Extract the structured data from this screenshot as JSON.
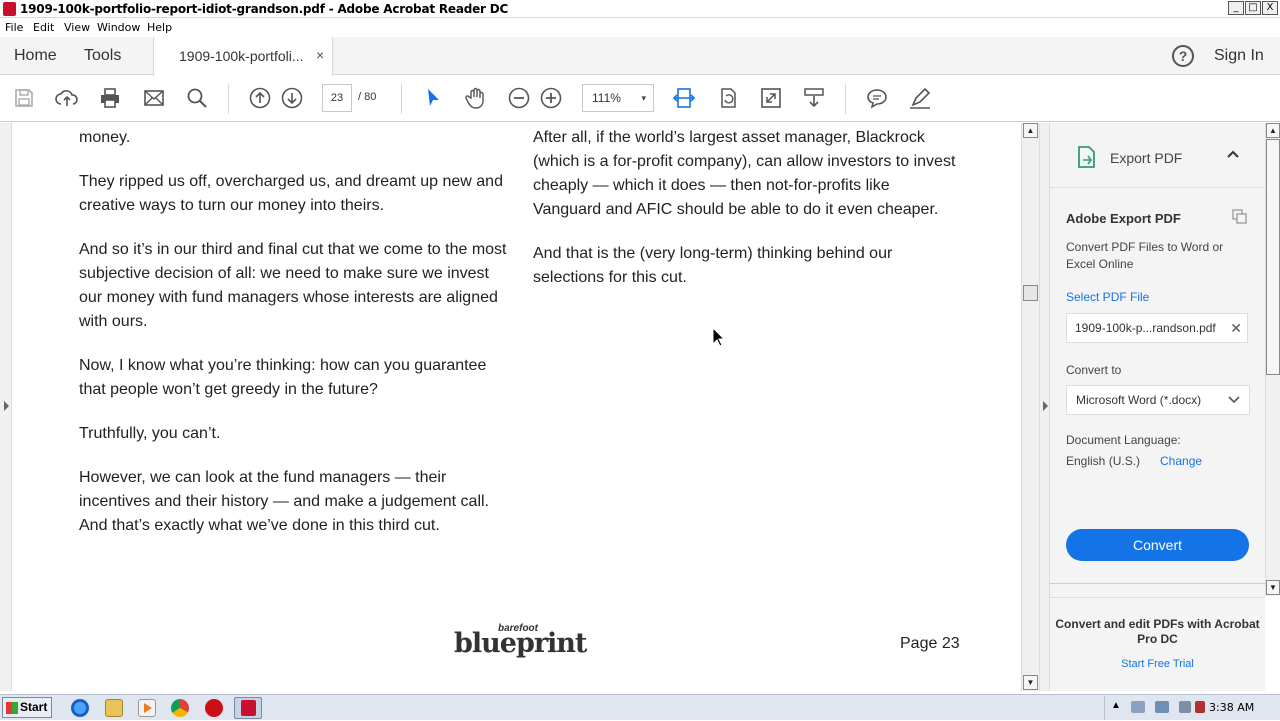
{
  "window": {
    "title": "1909-100k-portfolio-report-idiot-grandson.pdf - Adobe Acrobat Reader DC",
    "controls": [
      "_",
      "□",
      "X"
    ]
  },
  "menu": [
    "File",
    "Edit",
    "View",
    "Window",
    "Help"
  ],
  "tabs": {
    "home": "Home",
    "tools": "Tools",
    "document_tab": "1909-100k-portfoli...",
    "close": "×",
    "help": "?",
    "sign_in": "Sign In"
  },
  "toolbar": {
    "current_page": "23",
    "total_pages": "/ 80",
    "zoom": "111%",
    "zoom_caret": "▾",
    "icons": [
      "save-icon",
      "upload-icon",
      "print-icon",
      "email-icon",
      "search-icon",
      "page-up-icon",
      "page-down-icon",
      "select-tool-icon",
      "hand-tool-icon",
      "zoom-out-icon",
      "zoom-in-icon",
      "fit-width-icon",
      "rotate-icon",
      "fullscreen-icon",
      "scroll-mode-icon",
      "comment-icon",
      "highlight-icon"
    ]
  },
  "document": {
    "left_column": [
      "money.",
      "They ripped us off, overcharged us, and dreamt up new and creative ways to turn our money into theirs.",
      "And so it’s in our third and final cut that we come to the most subjective decision of all: we need to make sure we invest our money with fund managers whose interests are aligned with ours.",
      "Now, I know what you’re thinking: how can you guarantee that people won’t get greedy in the future?",
      "Truthfully, you can’t.",
      "However, we can look at the fund managers — their incentives and their history — and make a judgement call. And that’s exactly what we’ve done in this third cut."
    ],
    "right_column": [
      "After all, if the world’s largest asset manager, Blackrock (which is a for-profit company), can allow investors to invest cheaply — which it does — then not-for-profits like Vanguard and AFIC should be able to do it even cheaper.",
      "And that is the (very long-term) thinking behind our selections for this cut."
    ],
    "logo_small": "barefoot",
    "logo_big": "blueprint",
    "page_label": "Page 23"
  },
  "panel": {
    "header": "Export PDF",
    "title": "Adobe Export PDF",
    "description": "Convert PDF Files to Word or Excel Online",
    "select_file_label": "Select PDF File",
    "file_name": "1909-100k-p...randson.pdf",
    "convert_to_label": "Convert to",
    "convert_to_value": "Microsoft Word (*.docx)",
    "doc_language_label": "Document Language:",
    "doc_language_value": "English (U.S.)",
    "change_link": "Change",
    "convert_button": "Convert",
    "promo_text": "Convert and edit PDFs with Acrobat Pro DC",
    "trial_link": "Start Free Trial"
  },
  "taskbar": {
    "start": "Start",
    "clock": "3:38 AM"
  },
  "colors": {
    "accent": "#1473e6",
    "acrobat_red": "#c8102e"
  }
}
